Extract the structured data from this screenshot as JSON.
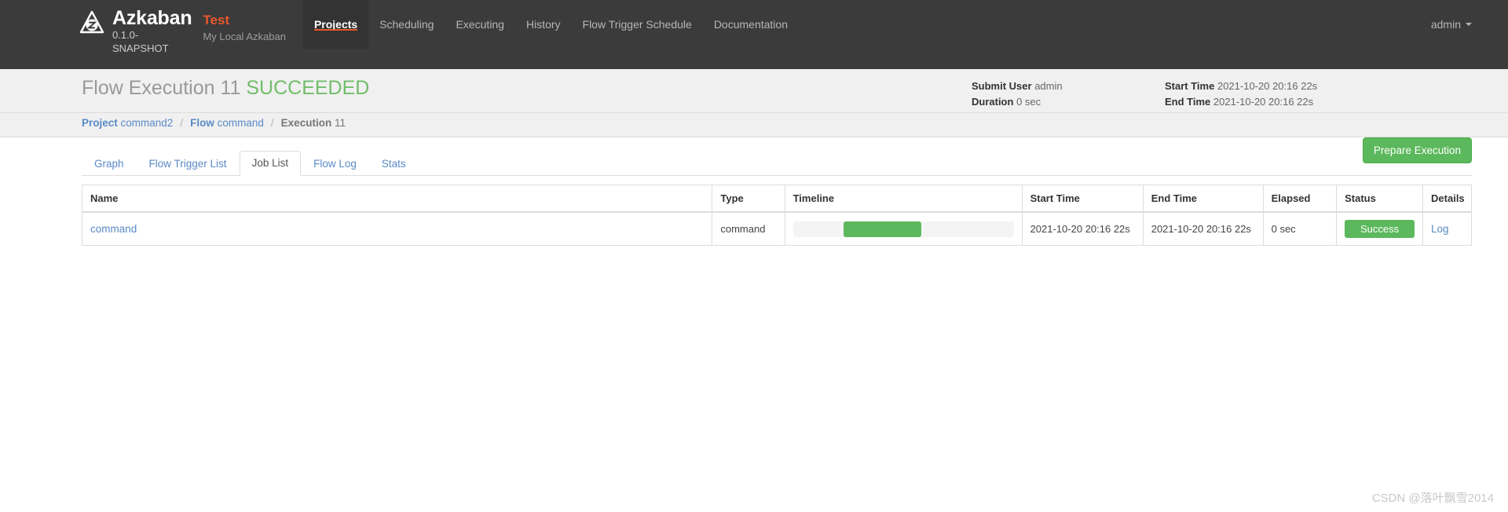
{
  "navbar": {
    "logo_icon": "azkaban-triangle-logo",
    "brand_name": "Azkaban",
    "version": "0.1.0-SNAPSHOT",
    "instance_name": "Test",
    "instance_sub": "My Local Azkaban",
    "links": [
      {
        "label": "Projects",
        "active": true
      },
      {
        "label": "Scheduling",
        "active": false
      },
      {
        "label": "Executing",
        "active": false
      },
      {
        "label": "History",
        "active": false
      },
      {
        "label": "Flow Trigger Schedule",
        "active": false
      },
      {
        "label": "Documentation",
        "active": false
      }
    ],
    "user": "admin",
    "accent_color": "#e8572c",
    "background_color": "#3b3b3b"
  },
  "execution": {
    "title_prefix": "Flow Execution 11",
    "status": "SUCCEEDED",
    "status_color": "#71bd6a",
    "meta": {
      "submit_user_label": "Submit User",
      "submit_user_value": "admin",
      "duration_label": "Duration",
      "duration_value": "0 sec",
      "start_time_label": "Start Time",
      "start_time_value": "2021-10-20 20:16 22s",
      "end_time_label": "End Time",
      "end_time_value": "2021-10-20 20:16 22s"
    }
  },
  "breadcrumb": [
    {
      "label": "Project",
      "value": "command2",
      "link": true
    },
    {
      "label": "Flow",
      "value": "command",
      "link": true
    },
    {
      "label": "Execution",
      "value": "11",
      "link": false
    }
  ],
  "breadcrumb_separator": "/",
  "tabs": [
    {
      "label": "Graph",
      "active": false
    },
    {
      "label": "Flow Trigger List",
      "active": false
    },
    {
      "label": "Job List",
      "active": true
    },
    {
      "label": "Flow Log",
      "active": false
    },
    {
      "label": "Stats",
      "active": false
    }
  ],
  "prepare_button": {
    "label": "Prepare Execution",
    "color": "#5cb85c"
  },
  "job_table": {
    "columns": [
      "Name",
      "Type",
      "Timeline",
      "Start Time",
      "End Time",
      "Elapsed",
      "Status",
      "Details"
    ],
    "rows": [
      {
        "name": "command",
        "type": "command",
        "timeline": {
          "offset_pct": 23,
          "width_pct": 35,
          "bar_color": "#5cb85c"
        },
        "start_time": "2021-10-20 20:16 22s",
        "end_time": "2021-10-20 20:16 22s",
        "elapsed": "0 sec",
        "status": "Success",
        "status_color": "#5cb85c",
        "details": "Log"
      }
    ]
  },
  "watermark": "CSDN @落叶飘雪2014"
}
